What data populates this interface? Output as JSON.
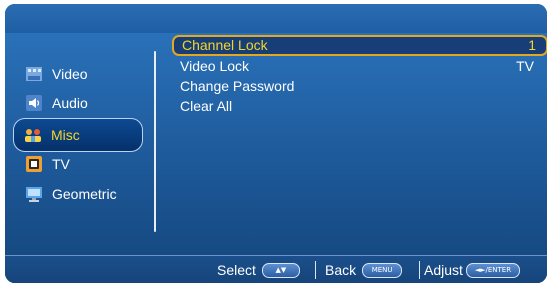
{
  "sidebar": {
    "items": [
      {
        "label": "Video",
        "icon": "video-icon",
        "selected": false
      },
      {
        "label": "Audio",
        "icon": "audio-icon",
        "selected": false
      },
      {
        "label": "Misc",
        "icon": "misc-icon",
        "selected": true
      },
      {
        "label": "TV",
        "icon": "tv-icon",
        "selected": false
      },
      {
        "label": "Geometric",
        "icon": "geometric-icon",
        "selected": false
      }
    ]
  },
  "menu": {
    "rows": [
      {
        "label": "Channel Lock",
        "value": "1",
        "selected": true
      },
      {
        "label": "Video Lock",
        "value": "TV",
        "selected": false
      },
      {
        "label": "Change Password",
        "value": "",
        "selected": false
      },
      {
        "label": "Clear All",
        "value": "",
        "selected": false
      }
    ]
  },
  "footer": {
    "select_label": "Select",
    "select_key": "▲▼",
    "back_label": "Back",
    "back_key": "MENU",
    "adjust_label": "Adjust",
    "adjust_key": "◄►/ENTER"
  },
  "colors": {
    "panel_blue": "#1d5796",
    "highlight_text": "#f4d52a",
    "selection_border": "#e2a91e"
  }
}
